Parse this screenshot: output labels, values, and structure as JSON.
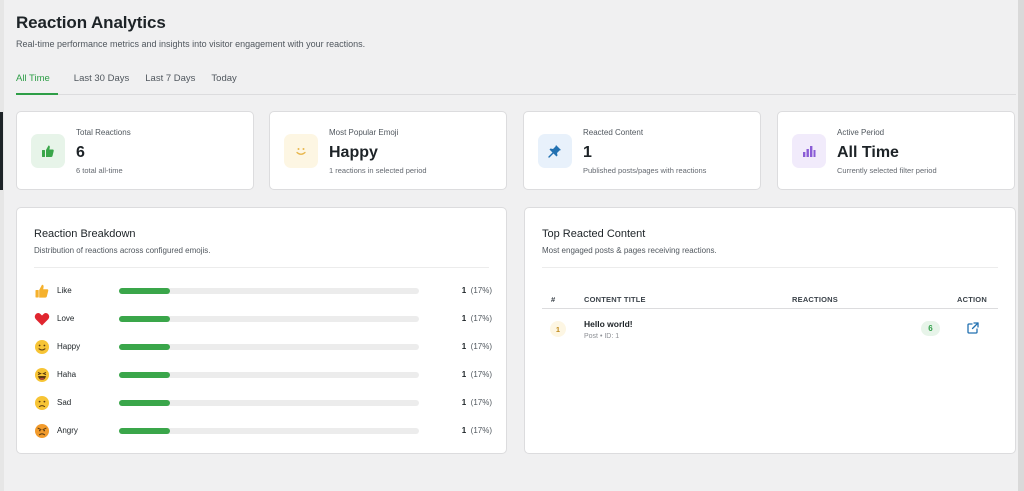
{
  "header": {
    "title": "Reaction Analytics",
    "subtitle": "Real-time performance metrics and insights into visitor engagement with your reactions."
  },
  "tabs": [
    {
      "label": "All Time",
      "active": true
    },
    {
      "label": "Last 30 Days",
      "active": false
    },
    {
      "label": "Last 7 Days",
      "active": false
    },
    {
      "label": "Today",
      "active": false
    }
  ],
  "stats": [
    {
      "label": "Total Reactions",
      "value": "6",
      "sub": "6 total all-time",
      "icon": "thumbs-up-icon",
      "icon_bg": "#e7f4e9",
      "icon_color": "#3aa64a"
    },
    {
      "label": "Most Popular Emoji",
      "value": "Happy",
      "sub": "1 reactions in selected period",
      "icon": "smiley-icon",
      "icon_bg": "#fdf6e3",
      "icon_color": "#e8b64c"
    },
    {
      "label": "Reacted Content",
      "value": "1",
      "sub": "Published posts/pages with reactions",
      "icon": "pin-icon",
      "icon_bg": "#e8f1fb",
      "icon_color": "#2271b1"
    },
    {
      "label": "Active Period",
      "value": "All Time",
      "sub": "Currently selected filter period",
      "icon": "bar-chart-icon",
      "icon_bg": "#f1ebfb",
      "icon_color": "#8a5cd6"
    }
  ],
  "breakdown": {
    "title": "Reaction Breakdown",
    "subtitle": "Distribution of reactions across configured emojis.",
    "rows": [
      {
        "emoji": "thumbs-up-emoji",
        "name": "Like",
        "count": "1",
        "pct": "(17%)",
        "fraction": 0.17
      },
      {
        "emoji": "heart-emoji",
        "name": "Love",
        "count": "1",
        "pct": "(17%)",
        "fraction": 0.17
      },
      {
        "emoji": "smiling-face-emoji",
        "name": "Happy",
        "count": "1",
        "pct": "(17%)",
        "fraction": 0.17
      },
      {
        "emoji": "laughing-face-emoji",
        "name": "Haha",
        "count": "1",
        "pct": "(17%)",
        "fraction": 0.17
      },
      {
        "emoji": "sad-face-emoji",
        "name": "Sad",
        "count": "1",
        "pct": "(17%)",
        "fraction": 0.17
      },
      {
        "emoji": "angry-face-emoji",
        "name": "Angry",
        "count": "1",
        "pct": "(17%)",
        "fraction": 0.17
      }
    ]
  },
  "top_content": {
    "title": "Top Reacted Content",
    "subtitle": "Most engaged posts & pages receiving reactions.",
    "columns": [
      "#",
      "CONTENT TITLE",
      "REACTIONS",
      "ACTION"
    ],
    "rows": [
      {
        "rank": "1",
        "title": "Hello world!",
        "meta": "Post • ID: 1",
        "reactions": "6",
        "action_icon": "external-link-icon"
      }
    ]
  }
}
